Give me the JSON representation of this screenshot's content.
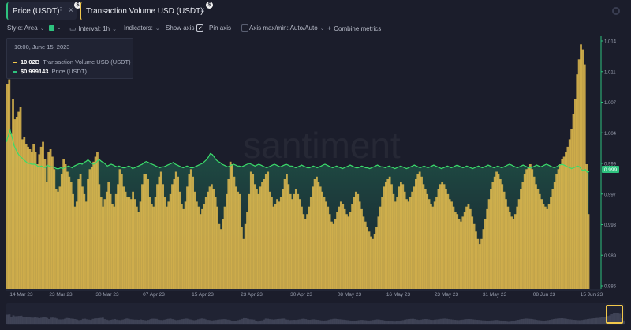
{
  "tabs": [
    {
      "label": "Price (USDT)",
      "dots": "⋮",
      "close": "×",
      "badge": "$",
      "accent": "#2ec27e"
    },
    {
      "label": "Transaction Volume USD (USDT)",
      "dots": "⋮",
      "close": "×",
      "badge": "$",
      "accent": "#f2c84b"
    }
  ],
  "toolbar": {
    "style": "Style: Area",
    "interval": "Interval: 1h",
    "indicators": "Indicators:",
    "show_axis": "Show axis",
    "pin_axis": "Pin axis",
    "axis_maxmin": "Axis max/min: Auto/Auto",
    "combine": "Combine metrics",
    "series_color": "#2ec27e"
  },
  "tooltip": {
    "date": "10:00, June 15, 2023",
    "rows": [
      {
        "value": "10.02B",
        "name": "Transaction Volume USD (USDT)",
        "color": "#f2c84b"
      },
      {
        "value": "$0.999143",
        "name": "Price (USDT)",
        "color": "#2ec27e"
      }
    ]
  },
  "watermark": "santiment",
  "chart_data": {
    "type": "area",
    "x_ticks": [
      "14 Mar 23",
      "23 Mar 23",
      "30 Mar 23",
      "07 Apr 23",
      "15 Apr 23",
      "23 Apr 23",
      "30 Apr 23",
      "08 May 23",
      "16 May 23",
      "23 May 23",
      "31 May 23",
      "08 Jun 23",
      "15 Jun 23"
    ],
    "y_right_ticks": [
      "1.014",
      "1.011",
      "1.007",
      "1.004",
      "0.999",
      "0.997",
      "0.993",
      "0.989",
      "0.986"
    ],
    "y_right_range": [
      0.986,
      1.014
    ],
    "current_price_label": "0.999",
    "series": [
      {
        "name": "Transaction Volume USD (USDT)",
        "color": "#f2c84b",
        "type": "bar",
        "values": [
          0.82,
          0.84,
          0.62,
          0.76,
          0.68,
          0.69,
          0.71,
          0.73,
          0.6,
          0.61,
          0.58,
          0.57,
          0.56,
          0.55,
          0.58,
          0.55,
          0.5,
          0.54,
          0.57,
          0.59,
          0.52,
          0.43,
          0.55,
          0.56,
          0.53,
          0.48,
          0.4,
          0.39,
          0.41,
          0.46,
          0.52,
          0.5,
          0.47,
          0.45,
          0.43,
          0.38,
          0.33,
          0.35,
          0.44,
          0.46,
          0.41,
          0.38,
          0.35,
          0.44,
          0.48,
          0.49,
          0.51,
          0.53,
          0.55,
          0.42,
          0.37,
          0.33,
          0.36,
          0.39,
          0.43,
          0.38,
          0.34,
          0.33,
          0.38,
          0.42,
          0.48,
          0.46,
          0.41,
          0.39,
          0.37,
          0.37,
          0.36,
          0.39,
          0.36,
          0.33,
          0.31,
          0.35,
          0.42,
          0.46,
          0.46,
          0.44,
          0.37,
          0.34,
          0.33,
          0.37,
          0.42,
          0.45,
          0.47,
          0.42,
          0.37,
          0.33,
          0.35,
          0.38,
          0.42,
          0.44,
          0.47,
          0.45,
          0.39,
          0.34,
          0.32,
          0.35,
          0.41,
          0.46,
          0.48,
          0.45,
          0.39,
          0.35,
          0.33,
          0.3,
          0.32,
          0.34,
          0.37,
          0.39,
          0.41,
          0.42,
          0.4,
          0.37,
          0.33,
          0.26,
          0.24,
          0.28,
          0.33,
          0.38,
          0.44,
          0.51,
          0.5,
          0.45,
          0.41,
          0.39,
          0.38,
          0.25,
          0.2,
          0.26,
          0.31,
          0.38,
          0.47,
          0.46,
          0.42,
          0.4,
          0.38,
          0.41,
          0.43,
          0.44,
          0.46,
          0.47,
          0.39,
          0.37,
          0.33,
          0.34,
          0.36,
          0.35,
          0.37,
          0.4,
          0.44,
          0.46,
          0.42,
          0.38,
          0.36,
          0.38,
          0.4,
          0.38,
          0.36,
          0.33,
          0.3,
          0.28,
          0.3,
          0.33,
          0.37,
          0.41,
          0.44,
          0.45,
          0.43,
          0.41,
          0.39,
          0.37,
          0.35,
          0.33,
          0.3,
          0.27,
          0.26,
          0.28,
          0.31,
          0.33,
          0.35,
          0.34,
          0.32,
          0.3,
          0.29,
          0.31,
          0.34,
          0.37,
          0.39,
          0.38,
          0.35,
          0.32,
          0.29,
          0.27,
          0.25,
          0.23,
          0.21,
          0.2,
          0.22,
          0.25,
          0.29,
          0.33,
          0.37,
          0.41,
          0.43,
          0.44,
          0.45,
          0.42,
          0.38,
          0.35,
          0.37,
          0.41,
          0.43,
          0.42,
          0.39,
          0.36,
          0.35,
          0.37,
          0.39,
          0.41,
          0.44,
          0.46,
          0.47,
          0.45,
          0.42,
          0.4,
          0.38,
          0.36,
          0.34,
          0.33,
          0.35,
          0.37,
          0.4,
          0.42,
          0.43,
          0.42,
          0.4,
          0.38,
          0.36,
          0.35,
          0.33,
          0.31,
          0.3,
          0.28,
          0.27,
          0.29,
          0.31,
          0.33,
          0.34,
          0.32,
          0.29,
          0.26,
          0.23,
          0.2,
          0.18,
          0.2,
          0.24,
          0.28,
          0.32,
          0.36,
          0.4,
          0.43,
          0.45,
          0.47,
          0.46,
          0.44,
          0.42,
          0.39,
          0.36,
          0.33,
          0.31,
          0.29,
          0.28,
          0.3,
          0.33,
          0.36,
          0.4,
          0.43,
          0.46,
          0.48,
          0.49,
          0.5,
          0.48,
          0.45,
          0.42,
          0.4,
          0.38,
          0.36,
          0.34,
          0.33,
          0.32,
          0.34,
          0.37,
          0.4,
          0.43,
          0.46,
          0.48,
          0.5,
          0.52,
          0.53,
          0.55,
          0.57,
          0.6,
          0.64,
          0.7,
          0.76,
          0.86,
          0.92,
          0.98,
          0.96,
          0.9,
          0.5,
          0.3
        ]
      },
      {
        "name": "Price (USDT)",
        "color": "#2ec27e",
        "type": "area",
        "values": [
          1.0025,
          1.0032,
          1.0038,
          1.003,
          1.0021,
          1.0016,
          1.0012,
          1.0009,
          1.0007,
          1.0005,
          1.0003,
          1.0001,
          1.0001,
          1.0,
          1.0,
          1.0,
          0.9998,
          0.9997,
          0.9998,
          0.9997,
          0.9996,
          0.9999,
          0.9998,
          0.9997,
          0.9997,
          0.9996,
          0.9995,
          0.9995,
          0.9996,
          0.9995,
          0.9996,
          0.9997,
          0.9998,
          0.9997,
          0.9996,
          0.9998,
          0.9999,
          1.0,
          1.0001,
          1.0,
          1.0002,
          1.0003,
          1.0005,
          1.0003,
          1.0001,
          1.0,
          1.0001,
          1.0004,
          1.0005,
          1.0003,
          1.0002,
          1.0,
          0.9998,
          0.9999,
          1.0,
          0.9999,
          0.9998,
          0.9997,
          0.9998,
          0.9997,
          0.9996,
          0.9996,
          0.9997,
          0.9998,
          0.9997,
          0.9995,
          0.9996,
          0.9997,
          0.9998,
          0.9999,
          1.0,
          1.0002,
          1.0003,
          1.0002,
          1.0001,
          1.0,
          0.9999,
          0.9998,
          0.9997,
          0.9996,
          0.9997,
          0.9997,
          0.9998,
          0.9999,
          1.0,
          1.0001,
          1.0002,
          1.0,
          0.9999,
          0.9998,
          0.9997,
          0.9996,
          0.9997,
          0.9998,
          0.9997,
          0.9996,
          0.9996,
          0.9997,
          0.9998,
          0.9999,
          1.0,
          1.0001,
          1.0003,
          1.0005,
          1.0008,
          1.0012,
          1.0011,
          1.0008,
          1.0005,
          1.0003,
          1.0002,
          1.0,
          0.9999,
          0.9998,
          0.9997,
          0.9998,
          0.9999,
          1.0,
          0.9999,
          0.9998,
          0.9998,
          0.9997,
          0.9998,
          0.9999,
          1.0,
          1.0001,
          1.0,
          0.9999,
          0.9998,
          0.9999,
          1.0,
          0.9999,
          0.9998,
          0.9997,
          0.9996,
          0.9997,
          0.9998,
          0.9999,
          1.0,
          0.9999,
          0.9998,
          0.9997,
          0.9998,
          0.9999,
          1.0,
          0.9999,
          0.9998,
          0.9998,
          0.9997,
          0.9996,
          0.9997,
          0.9998,
          0.9999,
          0.9998,
          0.9997,
          0.9996,
          0.9996,
          0.9997,
          0.9998,
          0.9997,
          0.9996,
          0.9997,
          0.9998,
          0.9999,
          1.0,
          0.9999,
          0.9998,
          0.9997,
          0.9996,
          0.9997,
          0.9998,
          0.9997,
          0.9996,
          0.9995,
          0.9996,
          0.9997,
          0.9998,
          0.9999,
          0.9998,
          0.9997,
          0.9996,
          0.9996,
          0.9997,
          0.9998,
          0.9997,
          0.9996,
          0.9996,
          0.9995,
          0.9996,
          0.9997,
          0.9998,
          0.9999,
          0.9998,
          0.9997,
          0.9997,
          0.9996,
          0.9997,
          0.9998,
          0.9997,
          0.9996,
          0.9995,
          0.9996,
          0.9997,
          0.9998,
          0.9997,
          0.9996,
          0.9995,
          0.9996,
          0.9997,
          0.9998,
          0.9999,
          0.9998,
          0.9997,
          0.9996,
          0.9997,
          0.9998,
          0.9997,
          0.9996,
          0.9997,
          0.9998,
          0.9999,
          0.9998,
          0.9997,
          0.9996,
          0.9995,
          0.9996,
          0.9997,
          0.9998,
          0.9997,
          0.9996,
          0.9997,
          0.9998,
          0.9999,
          0.9998,
          0.9997,
          0.9996,
          0.9997,
          0.9998,
          0.9997,
          0.9996,
          0.9995,
          0.9996,
          0.9997,
          0.9998,
          0.9997,
          0.9996,
          0.9997,
          0.9998,
          0.9999,
          0.9998,
          0.9997,
          0.9996,
          0.9997,
          0.9998,
          0.9997,
          0.9996,
          0.9997,
          0.9998,
          0.9999,
          1.0,
          0.9999,
          0.9998,
          0.9997,
          0.9996,
          0.9997,
          0.9998,
          0.9999,
          0.9998,
          0.9997,
          0.9996,
          0.9996,
          0.9997,
          0.9998,
          0.9999,
          0.9998,
          0.9997,
          0.9998,
          0.9999,
          1.0,
          0.9999,
          0.9998,
          0.9997,
          0.9996,
          0.9997,
          0.9998,
          0.9999,
          1.0,
          0.9999,
          0.9998,
          0.9997,
          0.9996,
          0.9995,
          0.9996,
          0.9997,
          0.9998,
          0.9997,
          0.9994,
          0.9993,
          0.9994,
          0.9991,
          0.9992
        ]
      }
    ],
    "legend": "tooltip top-left",
    "grid": false
  }
}
